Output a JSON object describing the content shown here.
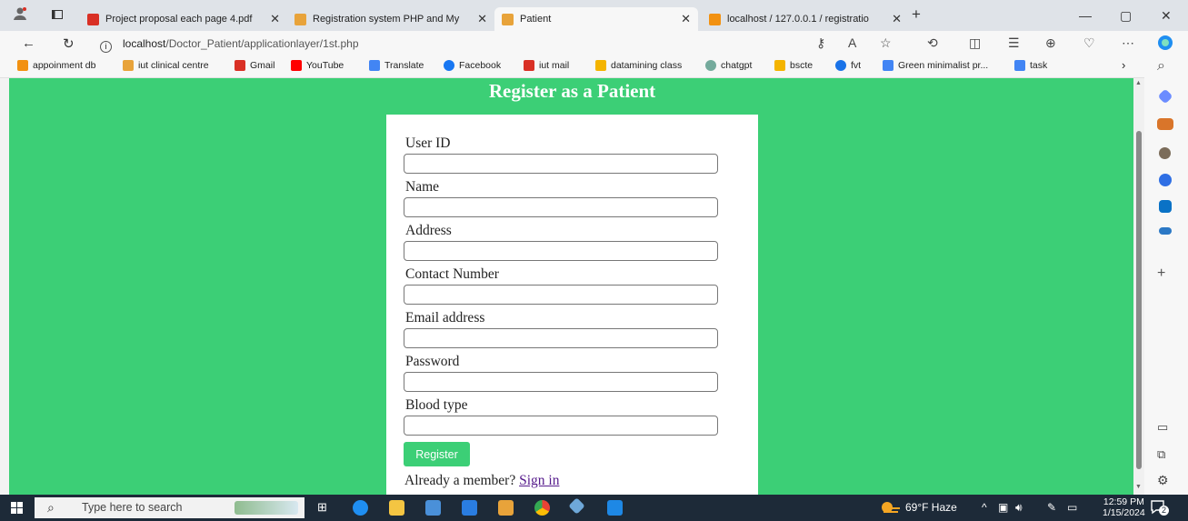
{
  "browser": {
    "tabs": [
      {
        "label": "Project proposal each page 4.pdf",
        "color": "#d93025"
      },
      {
        "label": "Registration system PHP and My",
        "color": "#e8a33a"
      },
      {
        "label": "Patient",
        "color": "#e8a33a",
        "active": true
      },
      {
        "label": "localhost / 127.0.0.1 / registratio",
        "color": "#f29111"
      }
    ],
    "new_tab_symbol": "+",
    "address": {
      "host": "localhost",
      "path": "/Doctor_Patient/applicationlayer/1st.php"
    },
    "bookmarks": [
      {
        "label": "appoinment db",
        "color": "#f29111"
      },
      {
        "label": "iut clinical centre",
        "color": "#e8a33a"
      },
      {
        "label": "Gmail",
        "color": "#d93025"
      },
      {
        "label": "YouTube",
        "color": "#ff0000"
      },
      {
        "label": "Translate",
        "color": "#4285f4"
      },
      {
        "label": "Facebook",
        "color": "#1877f2"
      },
      {
        "label": "iut mail",
        "color": "#d93025"
      },
      {
        "label": "datamining class",
        "color": "#f4b400"
      },
      {
        "label": "chatgpt",
        "color": "#74aa9c"
      },
      {
        "label": "bscte",
        "color": "#f4b400"
      },
      {
        "label": "fvt",
        "color": "#1a73e8"
      },
      {
        "label": "Green minimalist pr...",
        "color": "#4285f4"
      },
      {
        "label": "task",
        "color": "#4285f4"
      }
    ]
  },
  "form": {
    "title": "Register as a Patient",
    "fields": [
      {
        "label": "User ID",
        "value": ""
      },
      {
        "label": "Name",
        "value": ""
      },
      {
        "label": "Address",
        "value": ""
      },
      {
        "label": "Contact Number",
        "value": ""
      },
      {
        "label": "Email address",
        "value": ""
      },
      {
        "label": "Password",
        "value": ""
      },
      {
        "label": "Blood type",
        "value": ""
      }
    ],
    "submit_label": "Register",
    "member_text": "Already a member?",
    "signin_label": "Sign in",
    "accent_color": "#3ccf76"
  },
  "taskbar": {
    "search_placeholder": "Type here to search",
    "weather": "69°F  Haze",
    "time": "12:59 PM",
    "date": "1/15/2024",
    "notification_count": "2"
  }
}
